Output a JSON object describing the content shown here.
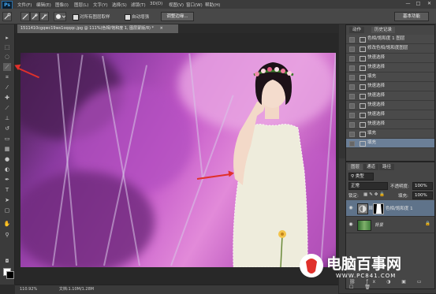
{
  "app": {
    "logo": "Ps"
  },
  "menu": [
    "文件(F)",
    "编辑(E)",
    "图像(I)",
    "图层(L)",
    "文字(Y)",
    "选择(S)",
    "滤镜(T)",
    "3D(D)",
    "视图(V)",
    "窗口(W)",
    "帮助(H)"
  ],
  "window_controls": {
    "minimize": "—",
    "restore": "□",
    "close": "✕"
  },
  "options_bar": {
    "sample_all_layers": "对所有图层取样",
    "auto_enhance": "自动增强",
    "refine_edge": "调整边缘...",
    "workspace": "基本功能"
  },
  "document": {
    "tab_title": "1511410cgqwc19ws1oqqqc.jpg @ 111%(色相/饱和度 1, 图层蒙版/8) *",
    "tab_close": "×",
    "zoom": "110.92%",
    "doc_size": "文档:1.10M/1.28M"
  },
  "tools": [
    "move-icon",
    "marquee-icon",
    "lasso-icon",
    "quick-select-icon",
    "crop-icon",
    "eyedropper-icon",
    "healing-icon",
    "brush-icon",
    "clone-icon",
    "history-brush-icon",
    "eraser-icon",
    "gradient-icon",
    "blur-icon",
    "dodge-icon",
    "pen-icon",
    "type-icon",
    "path-select-icon",
    "shape-icon",
    "hand-icon",
    "zoom-icon"
  ],
  "panel_tabs": {
    "actions": "动作",
    "history": "历史记录"
  },
  "history": {
    "items": [
      {
        "label": "色相/饱和度 1 图层",
        "icon": "adjust-icon"
      },
      {
        "label": "修改色相/饱和度图层",
        "icon": "adjust-icon"
      },
      {
        "label": "快速选择",
        "icon": "quick-select-icon"
      },
      {
        "label": "快速选择",
        "icon": "quick-select-icon"
      },
      {
        "label": "填充",
        "icon": "fill-icon"
      },
      {
        "label": "快速选择",
        "icon": "quick-select-icon"
      },
      {
        "label": "快速选择",
        "icon": "quick-select-icon"
      },
      {
        "label": "快速选择",
        "icon": "quick-select-icon"
      },
      {
        "label": "快速选择",
        "icon": "quick-select-icon"
      },
      {
        "label": "快速选择",
        "icon": "quick-select-icon"
      },
      {
        "label": "填充",
        "icon": "fill-icon"
      },
      {
        "label": "填充",
        "icon": "fill-icon"
      }
    ],
    "selected_index": 11
  },
  "layers_panel": {
    "tabs": [
      "图层",
      "通道",
      "路径"
    ],
    "filter_kind": "类型",
    "blend_mode": "正常",
    "opacity_label": "不透明度:",
    "opacity_value": "100%",
    "lock_label": "锁定:",
    "fill_label": "填充:",
    "fill_value": "100%",
    "layers": [
      {
        "name": "色相/饱和度 1"
      },
      {
        "name": "背景"
      }
    ]
  },
  "watermark": {
    "brand": "电脑百事网",
    "url": "WWW.PC841.COM"
  },
  "colors": {
    "accent_red": "#e0302b",
    "ps_blue": "#3fa7f5",
    "selected_row": "#6b7f97"
  }
}
